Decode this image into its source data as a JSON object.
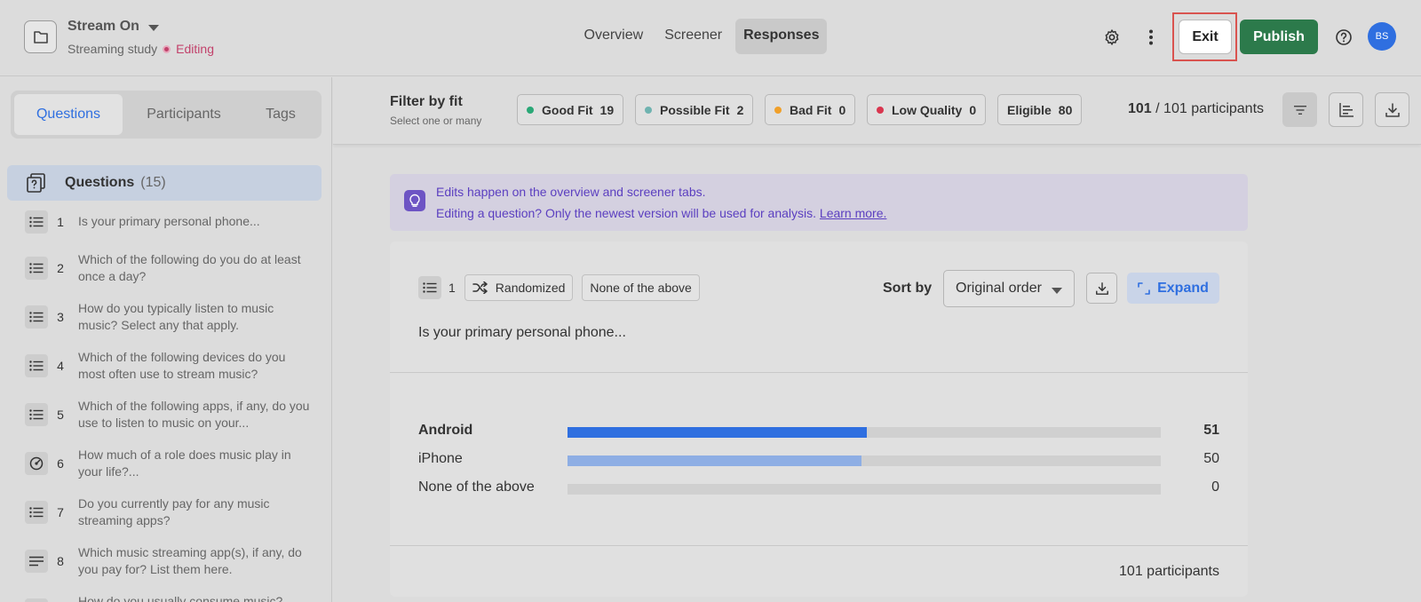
{
  "project": {
    "title": "Stream On",
    "subtitle": "Streaming study",
    "status": "Editing"
  },
  "nav": {
    "tabs": [
      {
        "label": "Overview",
        "active": false
      },
      {
        "label": "Screener",
        "active": false
      },
      {
        "label": "Responses",
        "active": true
      }
    ]
  },
  "actions": {
    "exit_label": "Exit",
    "publish_label": "Publish",
    "avatar_initials": "BS",
    "icons": [
      "gear-icon",
      "more-vertical-icon",
      "help-icon"
    ]
  },
  "sidebar": {
    "tabs": [
      {
        "label": "Questions",
        "active": true
      },
      {
        "label": "Participants",
        "active": false
      },
      {
        "label": "Tags",
        "active": false
      }
    ],
    "questions_header": {
      "title": "Questions",
      "count": "(15)"
    },
    "questions": [
      {
        "num": "1",
        "type_icon": "list-icon",
        "text": "Is your primary personal phone..."
      },
      {
        "num": "2",
        "type_icon": "list-icon",
        "text": "Which of the following do you do at least once a day?"
      },
      {
        "num": "3",
        "type_icon": "list-icon",
        "text": "How do you typically listen to music music? Select any that apply."
      },
      {
        "num": "4",
        "type_icon": "list-icon",
        "text": "Which of the following devices do you most often use to stream music?"
      },
      {
        "num": "5",
        "type_icon": "list-icon",
        "text": "Which of the following apps, if any, do you use to listen to music on your..."
      },
      {
        "num": "6",
        "type_icon": "gauge-icon",
        "text": "How much of a role does music play in your life?..."
      },
      {
        "num": "7",
        "type_icon": "list-icon",
        "text": "Do you currently pay for any music streaming apps?"
      },
      {
        "num": "8",
        "type_icon": "text-lines-icon",
        "text": "Which music streaming app(s), if any, do you pay for? List them here."
      },
      {
        "num": "",
        "type_icon": "list-icon",
        "text": "How do you usually consume music?"
      }
    ]
  },
  "filter": {
    "title": "Filter by fit",
    "subtitle": "Select one or many",
    "chips": [
      {
        "label": "Good Fit",
        "count": "19",
        "color": "#2aa877"
      },
      {
        "label": "Possible Fit",
        "count": "2",
        "color": "#6fb3b0"
      },
      {
        "label": "Bad Fit",
        "count": "0",
        "color": "#f0a02a"
      },
      {
        "label": "Low Quality",
        "count": "0",
        "color": "#d9364f"
      },
      {
        "label": "Eligible",
        "count": "80",
        "color": ""
      }
    ],
    "participants_shown": "101",
    "participants_total_text": "/ 101 participants"
  },
  "banner": {
    "line1": "Edits happen on the overview and screener tabs.",
    "line2": "Editing a question? Only the newest version will be used for analysis.",
    "link": "Learn more."
  },
  "card": {
    "number": "1",
    "tags": [
      "Randomized",
      "None of the above"
    ],
    "sort_label": "Sort by",
    "sort_value": "Original order",
    "expand_label": "Expand",
    "question": "Is your primary personal phone...",
    "footer": "101 participants",
    "accent": "#2f6fe0",
    "chart_data": {
      "type": "bar",
      "categories": [
        "Android",
        "iPhone",
        "None of the above"
      ],
      "values": [
        51,
        50,
        0
      ],
      "total": 101,
      "colors": [
        "#2f6fe0",
        "#8eaee4",
        "#d0d0d0"
      ]
    }
  }
}
